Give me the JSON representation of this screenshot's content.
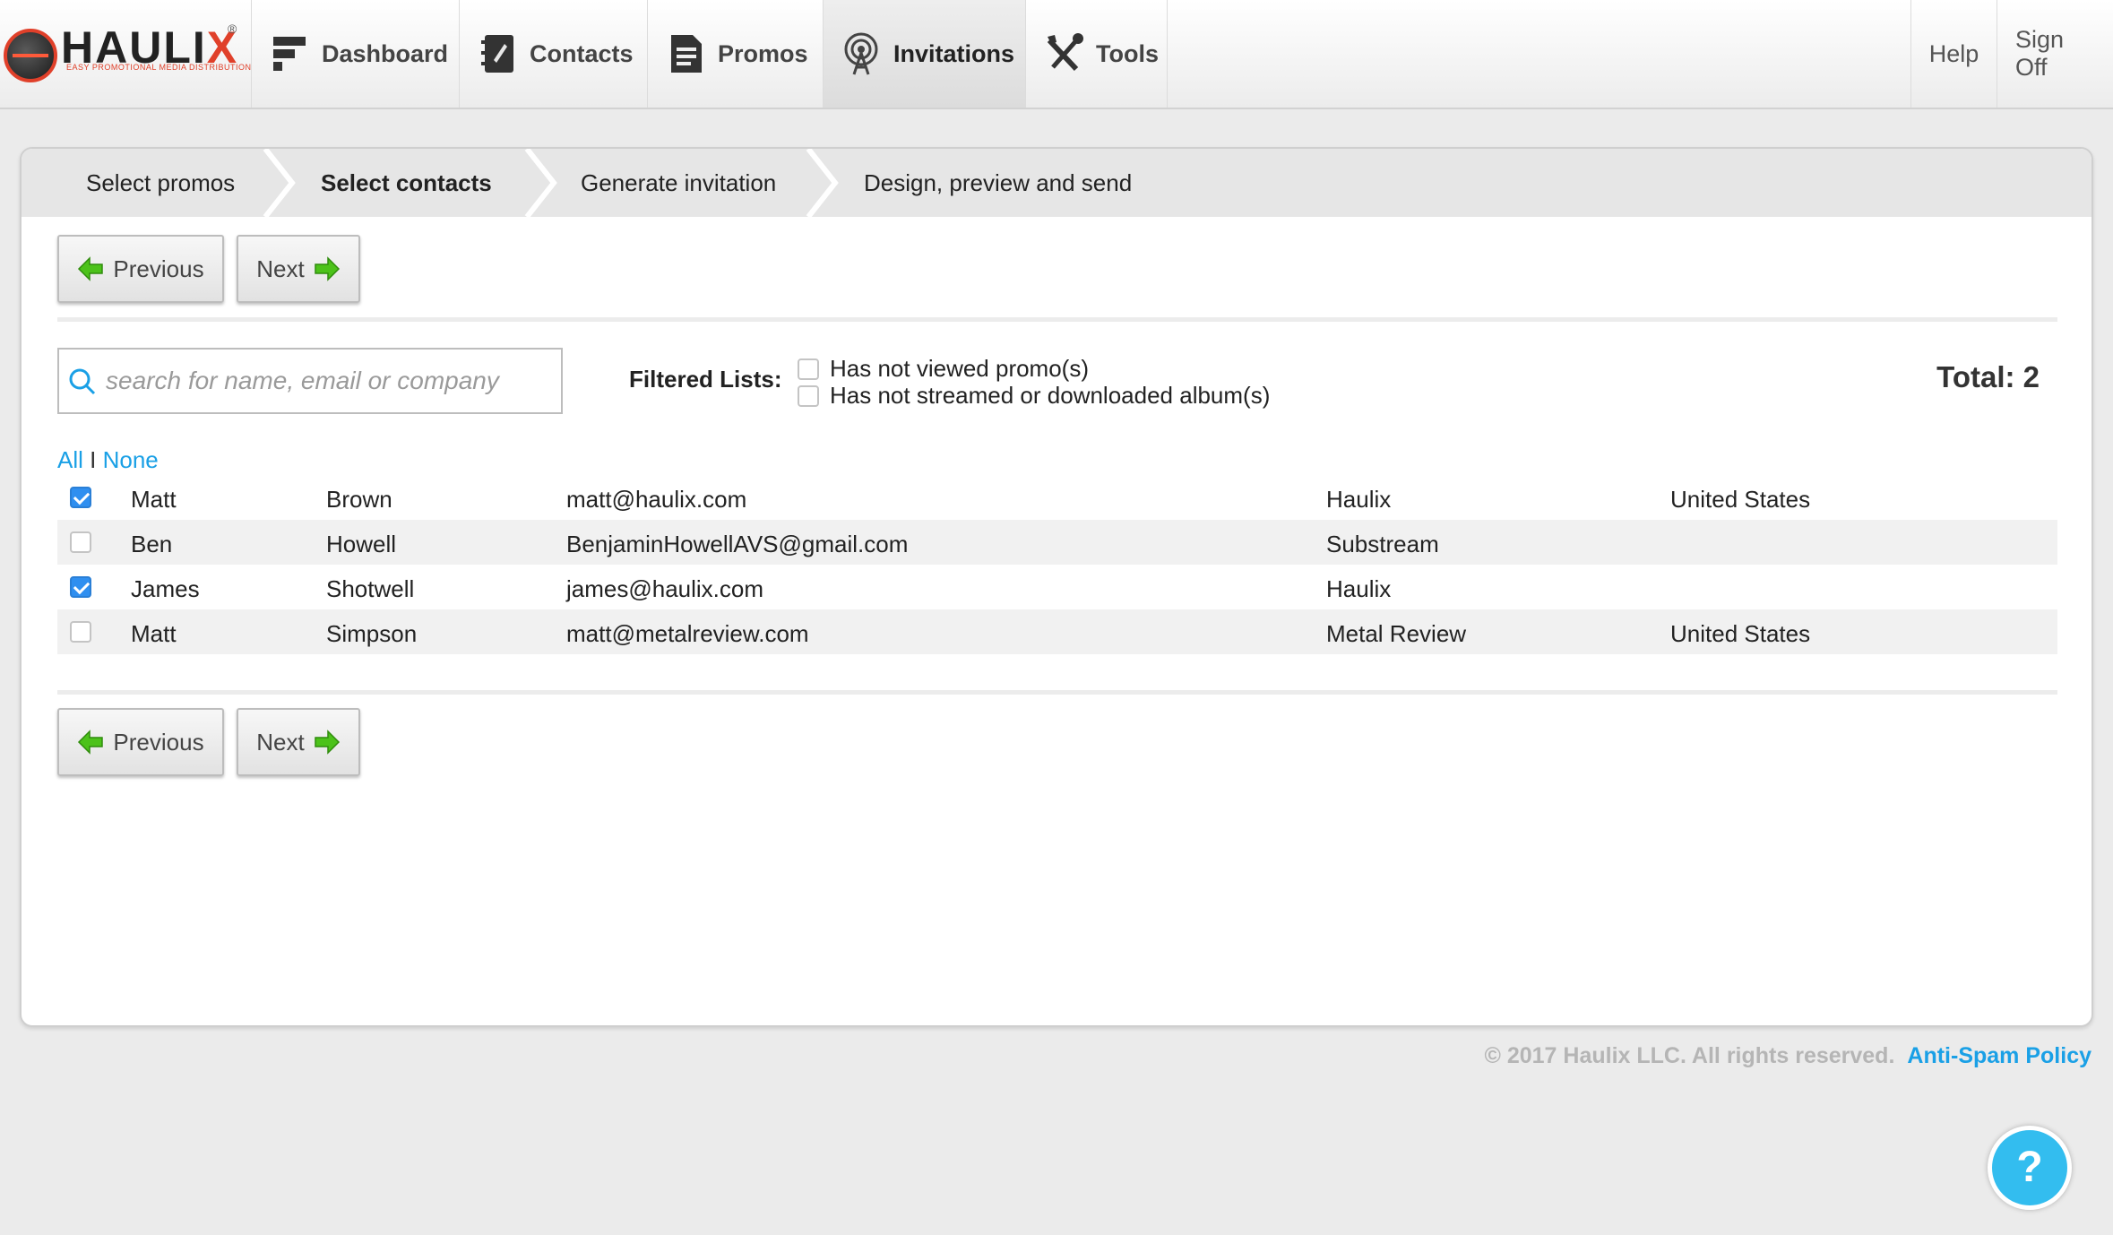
{
  "brand": {
    "name_main": "HAULI",
    "name_x": "X",
    "tagline": "EASY PROMOTIONAL MEDIA DISTRIBUTION",
    "reg": "®"
  },
  "nav": {
    "items": [
      {
        "label": "Dashboard",
        "icon": "dashboard-icon"
      },
      {
        "label": "Contacts",
        "icon": "contacts-icon"
      },
      {
        "label": "Promos",
        "icon": "promos-icon"
      },
      {
        "label": "Invitations",
        "icon": "invitations-icon",
        "active": true
      },
      {
        "label": "Tools",
        "icon": "tools-icon"
      }
    ],
    "help": "Help",
    "signoff": "Sign Off"
  },
  "steps": [
    {
      "label": "Select promos"
    },
    {
      "label": "Select contacts",
      "active": true
    },
    {
      "label": "Generate invitation"
    },
    {
      "label": "Design, preview and send"
    }
  ],
  "buttons": {
    "previous": "Previous",
    "next": "Next"
  },
  "search": {
    "placeholder": "search for name, email or company",
    "value": ""
  },
  "filters": {
    "label": "Filtered Lists:",
    "options": [
      {
        "label": "Has not viewed promo(s)",
        "checked": false
      },
      {
        "label": "Has not streamed or downloaded album(s)",
        "checked": false
      }
    ]
  },
  "total": "Total: 2",
  "select": {
    "all": "All",
    "sep": "I",
    "none": "None"
  },
  "contacts": [
    {
      "first": "Matt",
      "last": "Brown",
      "email": "matt@haulix.com",
      "company": "Haulix",
      "country": "United States",
      "checked": true
    },
    {
      "first": "Ben",
      "last": "Howell",
      "email": "BenjaminHowellAVS@gmail.com",
      "company": "Substream",
      "country": "",
      "checked": false
    },
    {
      "first": "James",
      "last": "Shotwell",
      "email": "james@haulix.com",
      "company": "Haulix",
      "country": "",
      "checked": true
    },
    {
      "first": "Matt",
      "last": "Simpson",
      "email": "matt@metalreview.com",
      "company": "Metal Review",
      "country": "United States",
      "checked": false
    }
  ],
  "footer": {
    "copyright": "© 2017 Haulix LLC. All rights reserved.",
    "link": "Anti-Spam Policy"
  },
  "help_fab": "?",
  "colors": {
    "accent": "#1aa0e6",
    "check": "#2f8ff0",
    "arrow": "#4cc21a",
    "brand_red": "#e0402a"
  }
}
